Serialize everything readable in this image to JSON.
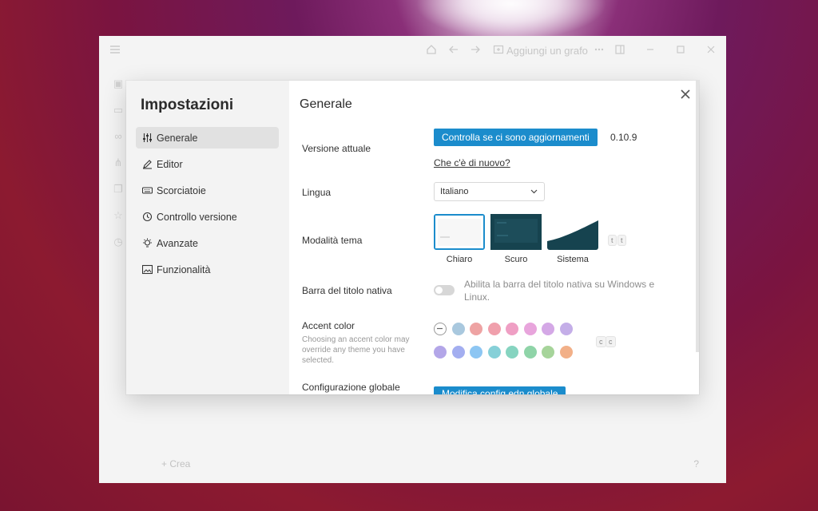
{
  "app": {
    "add_graph_label": "Aggiungi un grafo",
    "create_label": "+ Crea",
    "help_label": "?"
  },
  "settings": {
    "title": "Impostazioni",
    "nav": [
      {
        "label": "Generale",
        "icon": "sliders-icon",
        "active": true
      },
      {
        "label": "Editor",
        "icon": "pen-icon",
        "active": false
      },
      {
        "label": "Scorciatoie",
        "icon": "keyboard-icon",
        "active": false
      },
      {
        "label": "Controllo versione",
        "icon": "history-icon",
        "active": false
      },
      {
        "label": "Avanzate",
        "icon": "bulb-icon",
        "active": false
      },
      {
        "label": "Funzionalità",
        "icon": "image-icon",
        "active": false
      }
    ]
  },
  "general": {
    "title": "Generale",
    "version_label": "Versione attuale",
    "check_updates_button": "Controlla se ci sono aggiornamenti",
    "version_value": "0.10.9",
    "whats_new_link": "Che c'è di nuovo?",
    "language_label": "Lingua",
    "language_value": "Italiano",
    "theme_label": "Modalità tema",
    "themes": [
      {
        "name": "Chiaro",
        "selected": true
      },
      {
        "name": "Scuro",
        "selected": false
      },
      {
        "name": "Sistema",
        "selected": false
      }
    ],
    "theme_shortcut": [
      "t",
      "t"
    ],
    "native_titlebar_label": "Barra del titolo nativa",
    "native_titlebar_desc": "Abilita la barra del titolo nativa su Windows e Linux.",
    "native_titlebar_enabled": false,
    "accent_label": "Accent color",
    "accent_desc": "Choosing an accent color may override any theme you have selected.",
    "accent_shortcut": [
      "c",
      "c"
    ],
    "accent_colors_row1": [
      "none",
      "#a9c8de",
      "#eea3a3",
      "#f0a0ac",
      "#ef9fc4",
      "#e8a5dc",
      "#d4a8e6",
      "#c4aee8"
    ],
    "accent_colors_row2": [
      "#b3a6e8",
      "#a3aef0",
      "#8dc6f3",
      "#86d0d8",
      "#86d4c0",
      "#8fd4a8",
      "#a6d49a",
      "#f2b088"
    ],
    "global_config_label": "Configurazione globale",
    "global_config_button": "Modifica config.edn globale"
  }
}
